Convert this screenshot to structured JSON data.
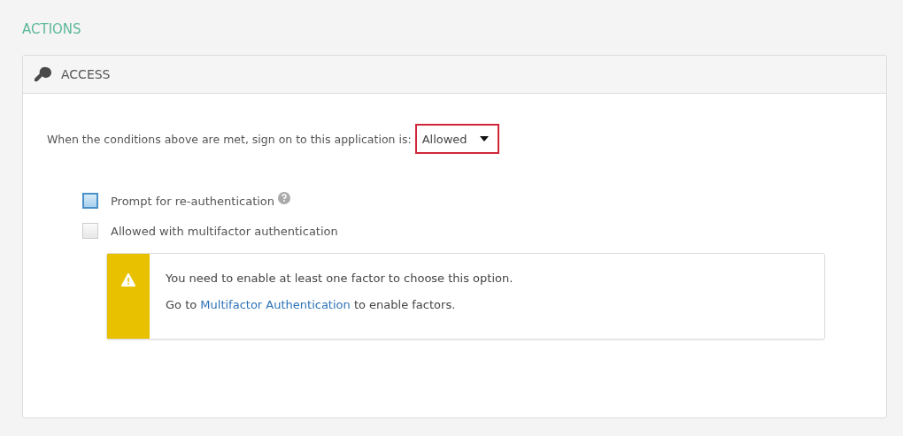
{
  "section_title": "ACTIONS",
  "panel": {
    "title": "ACCESS",
    "rule": {
      "label": "When the conditions above are met, sign on to this application is:",
      "value": "Allowed",
      "highlighted": true
    },
    "options": [
      {
        "label": "Prompt for re-authentication",
        "checked": false,
        "focused": true,
        "help": true
      },
      {
        "label": "Allowed with multifactor authentication",
        "checked": false,
        "focused": false,
        "help": false
      }
    ],
    "warning": {
      "message": "You need to enable at least one factor to choose this option.",
      "prefix": "Go to ",
      "link": "Multifactor Authentication",
      "suffix": " to enable factors."
    }
  }
}
